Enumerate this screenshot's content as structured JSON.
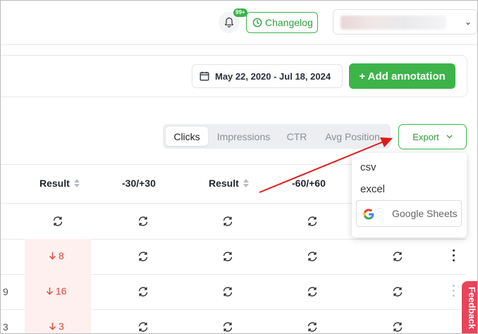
{
  "header": {
    "notification_badge": "99+",
    "changelog_label": "Changelog"
  },
  "toolbar": {
    "date_range": "May 22, 2020 - Jul 18, 2024",
    "add_annotation_label": "+ Add annotation"
  },
  "tabs": {
    "items": [
      "Clicks",
      "Impressions",
      "CTR",
      "Avg Position"
    ],
    "active": "Clicks"
  },
  "export": {
    "label": "Export",
    "options": [
      "csv",
      "excel"
    ],
    "google_sheets_label": "Google Sheets"
  },
  "table": {
    "headers": [
      "Result",
      "-30/+30",
      "Result",
      "-60/+60"
    ],
    "rows": [
      {
        "left": "",
        "result": ""
      },
      {
        "left": "",
        "result": "8"
      },
      {
        "left": "9",
        "result": "16"
      },
      {
        "left": "3",
        "result": "3"
      }
    ]
  },
  "feedback_label": "Feedback",
  "colors": {
    "accent_green": "#3db34a",
    "negative_red": "#e0453a",
    "feedback_pink": "#e94459",
    "annotation_arrow": "#e01b1b"
  }
}
